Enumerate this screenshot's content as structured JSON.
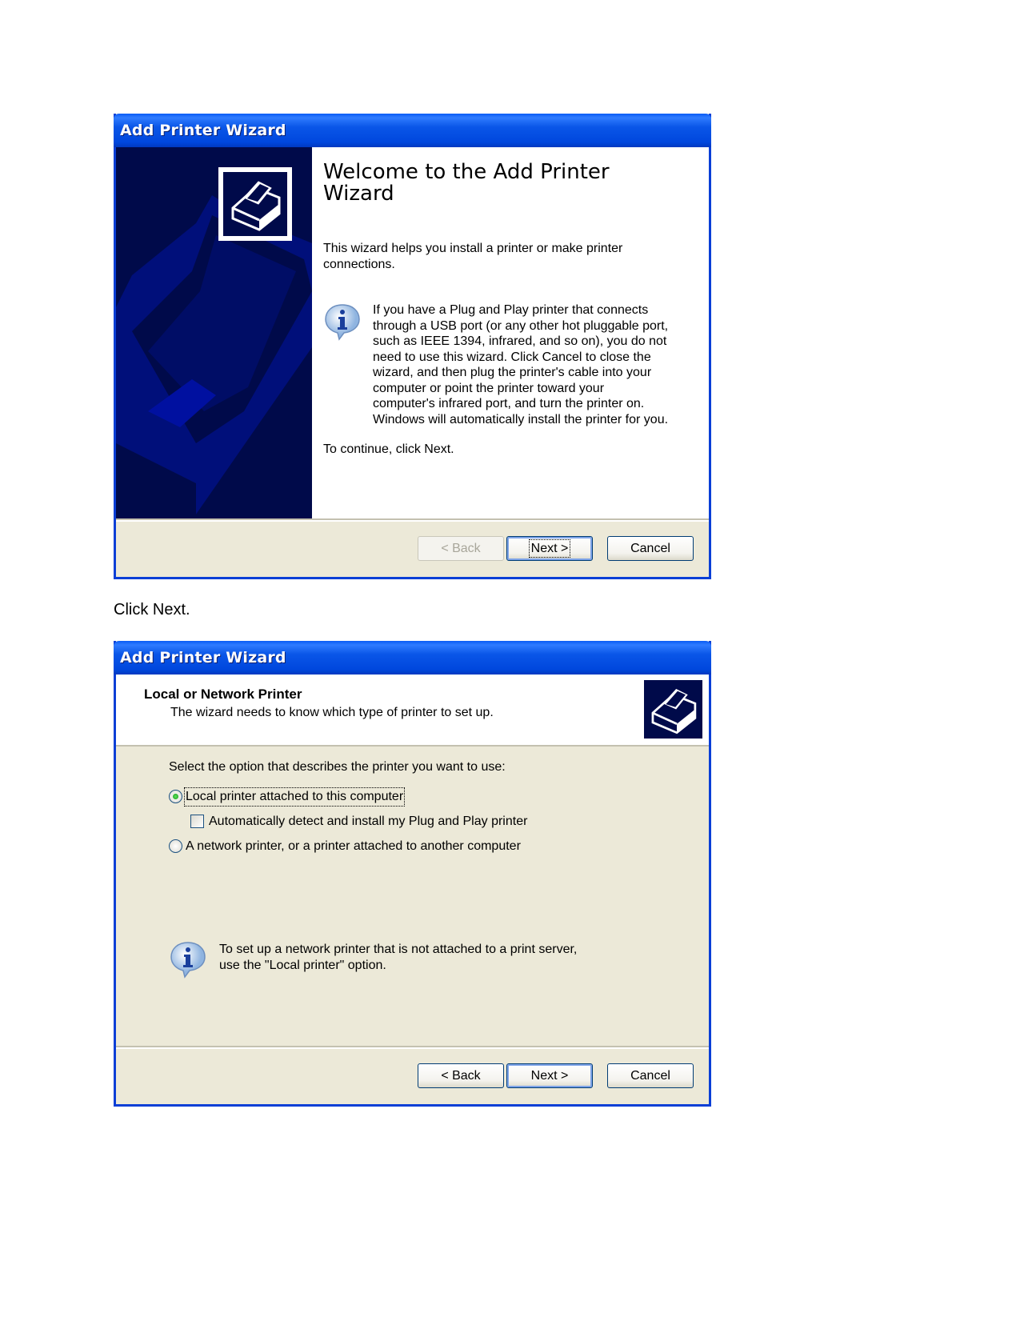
{
  "dialog1": {
    "window_title": "Add Printer Wizard",
    "heading": "Welcome to the Add Printer Wizard",
    "intro": "This wizard helps you install a printer or make printer connections.",
    "info_icon": "info-icon",
    "info_text": "If you have a Plug and Play printer that connects through a USB port (or any other hot pluggable port, such as IEEE 1394, infrared, and so on), you do not need to use this wizard. Click Cancel to close the wizard, and then plug the printer's cable into your computer or point the printer toward your computer's infrared port, and turn the printer on. Windows will automatically install the printer for you.",
    "continue_text": "To continue, click Next.",
    "buttons": {
      "back": {
        "label": "< Back",
        "enabled": false
      },
      "next": {
        "label": "Next >",
        "enabled": true,
        "default": true
      },
      "cancel": {
        "label": "Cancel",
        "enabled": true
      }
    }
  },
  "caption": "Click Next.",
  "dialog2": {
    "window_title": "Add Printer Wizard",
    "header_title": "Local or Network Printer",
    "header_subtitle": "The wizard needs to know which type of printer to set up.",
    "prompt": "Select the option that describes the printer you want to use:",
    "options": [
      {
        "type": "radio",
        "label": "Local printer attached to this computer",
        "selected": true
      },
      {
        "type": "checkbox",
        "label": "Automatically detect and install my Plug and Play printer",
        "checked": false
      },
      {
        "type": "radio",
        "label": "A network printer, or a printer attached to another computer",
        "selected": false
      }
    ],
    "info_text_line1": "To set up a network printer that is not attached to a print server,",
    "info_text_line2": "use the \"Local printer\" option.",
    "buttons": {
      "back": {
        "label": "< Back",
        "enabled": true
      },
      "next": {
        "label": "Next >",
        "enabled": true,
        "default": true
      },
      "cancel": {
        "label": "Cancel",
        "enabled": true
      }
    }
  },
  "colors": {
    "titlebar": "#0a56e8",
    "dialog_face": "#ece9d8",
    "sidebar_navy": "#000a4a"
  }
}
